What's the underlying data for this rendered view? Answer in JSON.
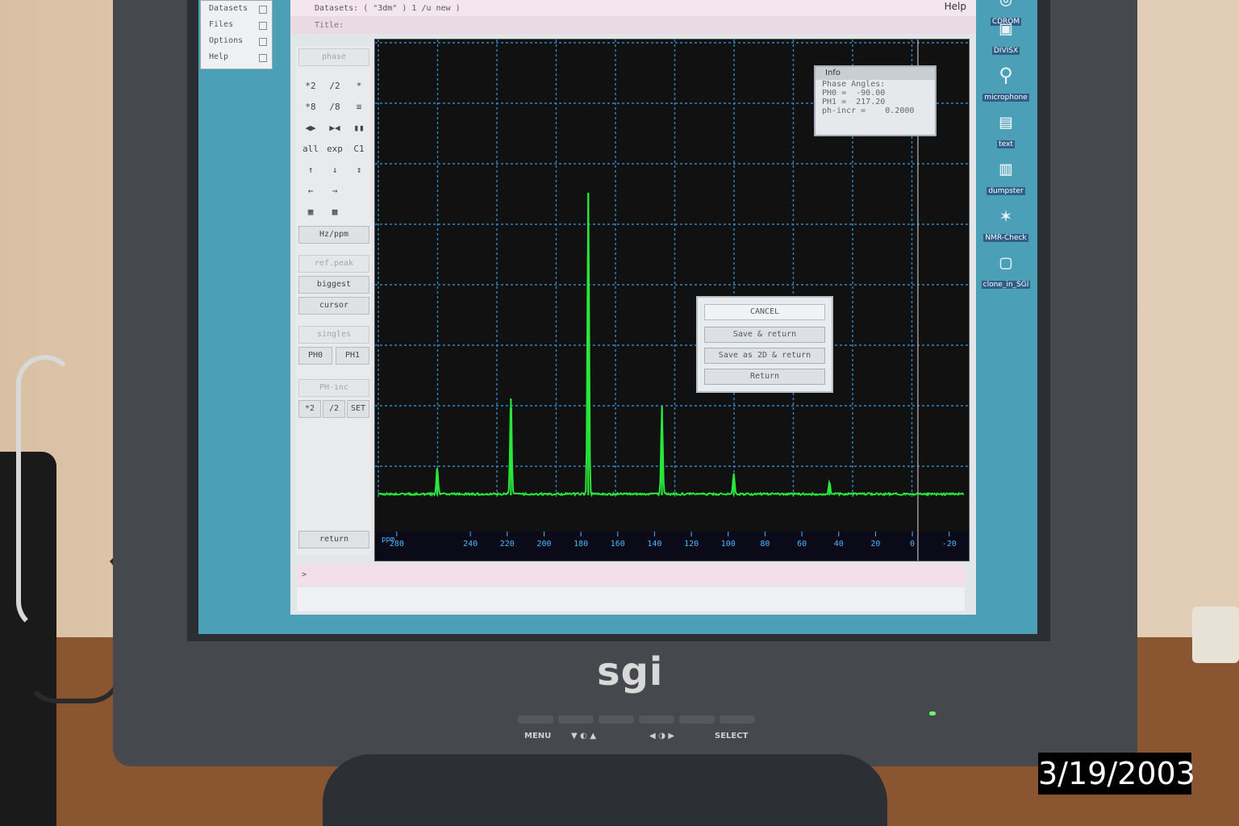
{
  "app": {
    "title_text": "Datasets: ( \"3dm\" ) 1 /u new )",
    "help_label": "Help",
    "subtitle": "Title:"
  },
  "menu": {
    "items": [
      "Datasets",
      "Files",
      "Options",
      "Help"
    ]
  },
  "toolbar": {
    "phase_label": "phase",
    "hz_ppm_label": "Hz/ppm",
    "refpeak_label": "ref.peak",
    "biggest_label": "biggest",
    "cursor_label": "cursor",
    "singles_label": "singles",
    "ph0_label": "PH0",
    "ph1_label": "PH1",
    "phinc_label": "PH-inc",
    "set_label": "SET",
    "return_label": "return",
    "icon_rows": [
      [
        "*2",
        "/2",
        "*"
      ],
      [
        "*8",
        "/8",
        "≡"
      ],
      [
        "◀▶",
        "▶◀",
        "▮▮"
      ],
      [
        "all",
        "exp",
        "C1"
      ],
      [
        "↑",
        "↓",
        "↕"
      ],
      [
        "←",
        "→",
        ""
      ],
      [
        "▦",
        "▩",
        ""
      ]
    ],
    "inc_row": [
      "*2",
      "/2",
      "SET"
    ]
  },
  "info_box": {
    "title": "Info",
    "lines": [
      "Phase Angles:",
      "PH0 =  -90.00",
      "PH1 =  217.20",
      "ph-incr =    0.2000"
    ]
  },
  "dialog": {
    "title": "CANCEL",
    "buttons": [
      "Save & return",
      "Save as 2D & return",
      "Return"
    ]
  },
  "desktop_icons": [
    {
      "label": "CDROM",
      "icon": "cdrom-icon"
    },
    {
      "label": "DIVISX",
      "icon": "network-icon"
    },
    {
      "label": "microphone",
      "icon": "microphone-icon"
    },
    {
      "label": "text",
      "icon": "document-icon"
    },
    {
      "label": "dumpster",
      "icon": "trash-icon"
    },
    {
      "label": "NMR-Check",
      "icon": "nmr-icon"
    },
    {
      "label": "clone_in_SGI",
      "icon": "terminal-icon"
    }
  ],
  "command_line": {
    "prompt": ">"
  },
  "monitor": {
    "brand": "sgi",
    "controls": [
      "MENU",
      "▼ ◐ ▲",
      "◀ ◑ ▶",
      "SELECT"
    ]
  },
  "date_stamp": "3/19/2003",
  "chart_data": {
    "type": "line",
    "xlabel": "ppm",
    "x_axis_unit_label": "ppm",
    "ticks": [
      "280",
      "240",
      "220",
      "200",
      "180",
      "160",
      "140",
      "120",
      "100",
      "80",
      "60",
      "40",
      "20",
      "0",
      "-20"
    ],
    "x_reversed": true,
    "xlim": [
      -28,
      290
    ],
    "grid": true,
    "line_color": "#28e83a",
    "peaks": [
      {
        "x": 258,
        "height": 0.09
      },
      {
        "x": 218,
        "height": 0.32
      },
      {
        "x": 176,
        "height": 1.0
      },
      {
        "x": 136,
        "height": 0.29
      },
      {
        "x": 97,
        "height": 0.07
      },
      {
        "x": 45,
        "height": 0.04
      }
    ],
    "cursor_x": -3
  },
  "colors": {
    "screen_bg": "#4b9fb7",
    "plot_bg": "#111111",
    "grid": "#2f87c4",
    "trace": "#28e83a"
  }
}
